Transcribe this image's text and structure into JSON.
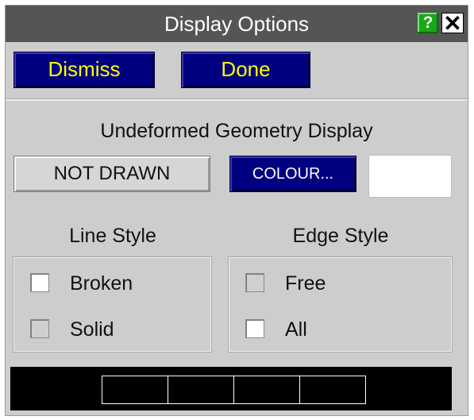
{
  "window": {
    "title": "Display Options",
    "help_label": "?",
    "close_label": "✕"
  },
  "actions": {
    "dismiss_label": "Dismiss",
    "done_label": "Done"
  },
  "undeformed": {
    "heading": "Undeformed Geometry Display",
    "mode_label": "NOT DRAWN",
    "colour_label": "COLOUR...",
    "colour_value": "#ffffff"
  },
  "line_style": {
    "heading": "Line Style",
    "options": [
      {
        "label": "Broken",
        "checked": true
      },
      {
        "label": "Solid",
        "checked": false
      }
    ]
  },
  "edge_style": {
    "heading": "Edge Style",
    "options": [
      {
        "label": "Free",
        "checked": false
      },
      {
        "label": "All",
        "checked": true
      }
    ]
  },
  "colors": {
    "title_bar": "#555555",
    "blue_button": "#000080",
    "button_text_yellow": "#ffff00",
    "panel": "#cdcdcd",
    "help_green": "#19a619"
  },
  "icons": {
    "help": "question-icon",
    "close": "close-icon"
  }
}
